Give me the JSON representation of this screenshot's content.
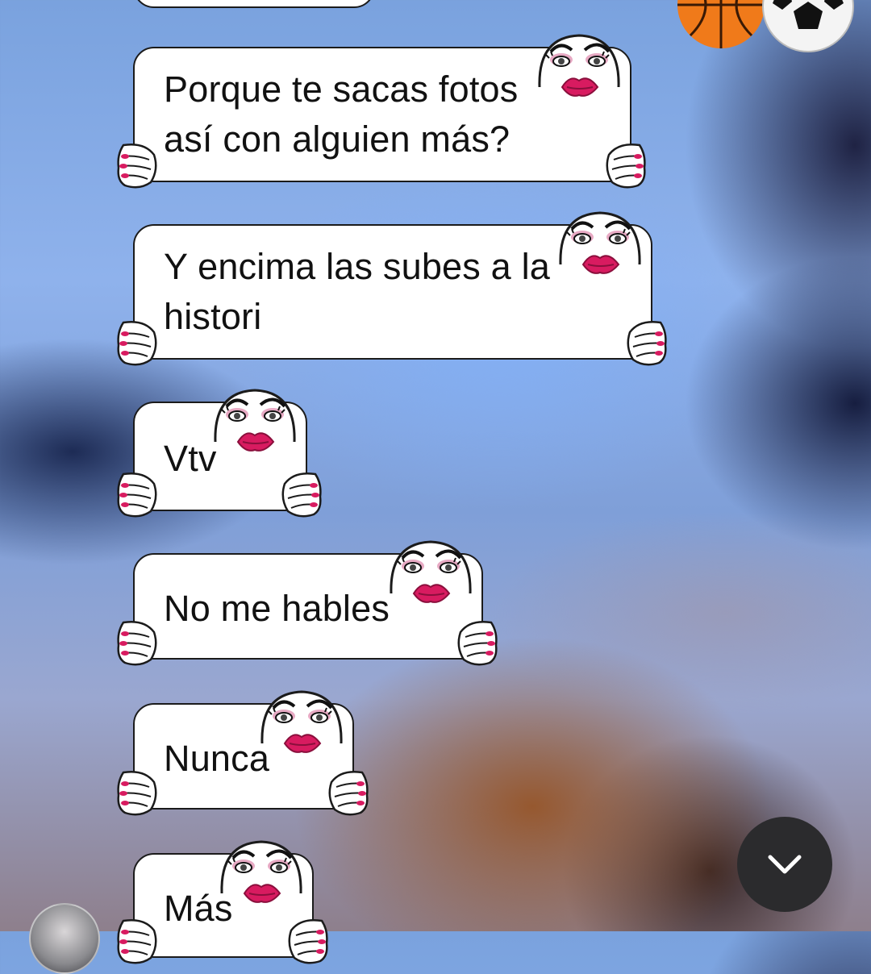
{
  "messages": [
    {
      "text": "Porque te sacas fotos\nasí con alguien más?"
    },
    {
      "text": "Y encima las subes a la\nhistori"
    },
    {
      "text": "Vtv"
    },
    {
      "text": "No me hables"
    },
    {
      "text": "Nunca"
    },
    {
      "text": "Más"
    }
  ],
  "icons": {
    "top_decoration": [
      "basketball-icon",
      "soccer-ball-icon"
    ],
    "bubble_decoration": [
      "cartoon-face-icon",
      "hand-icon"
    ],
    "scroll_button": "chevron-down-icon"
  },
  "colors": {
    "bubble_background": "#ffffff",
    "bubble_border": "#1b1b1b",
    "lips": "#d81b60",
    "fab": "#2b2b2d"
  }
}
